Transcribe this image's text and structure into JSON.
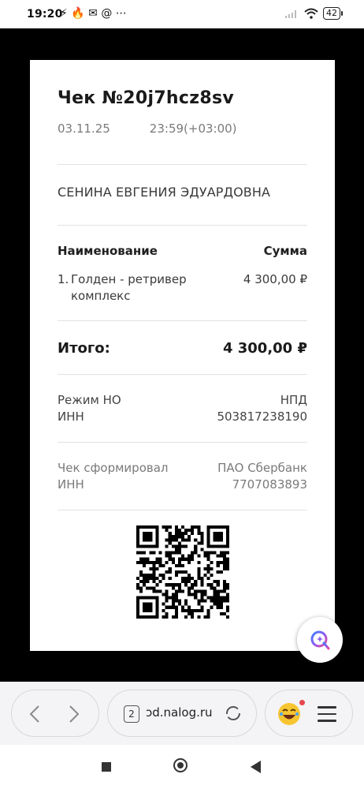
{
  "status_bar": {
    "time": "19:20",
    "left_icons": "⚡ 🔥 ✉ @ ⋯",
    "battery": "42"
  },
  "receipt": {
    "title": "Чек №20j7hcz8sv",
    "date": "03.11.25",
    "time": "23:59(+03:00)",
    "buyer": "СЕНИНА ЕВГЕНИЯ ЭДУАРДОВНА",
    "table": {
      "col_name": "Наименование",
      "col_sum": "Сумма",
      "items": [
        {
          "num": "1.",
          "name": "Голден - ретривер комплекс",
          "amount": "4 300,00 ₽"
        }
      ]
    },
    "total_label": "Итого:",
    "total_value": "4 300,00 ₽",
    "tax_mode_label": "Режим НО",
    "tax_mode_value": "НПД",
    "inn_label": "ИНН",
    "inn_value": "503817238190",
    "issuer_label": "Чек сформировал",
    "issuer_value": "ПАО Сбербанк",
    "issuer_inn_label": "ИНН",
    "issuer_inn_value": "7707083893"
  },
  "browser": {
    "tab_count": "2",
    "url": "ɔd.nalog.ru",
    "back_icon": "chevron-left",
    "forward_icon": "chevron-right"
  },
  "colors": {
    "background": "#000000",
    "paper": "#ffffff",
    "fab_accent": "#6c4cf1"
  }
}
